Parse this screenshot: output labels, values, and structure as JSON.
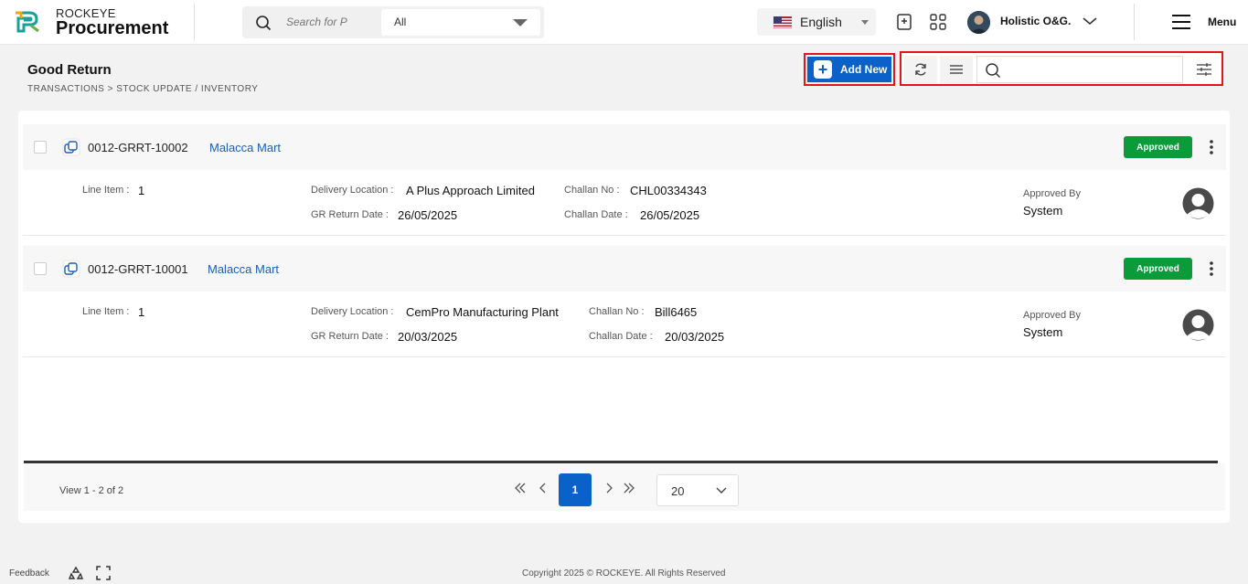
{
  "app": {
    "brand_top": "ROCKEYE",
    "brand_main": "Procurement"
  },
  "header": {
    "search_placeholder": "Search for P",
    "search_scope": "All",
    "language": "English",
    "user_name": "Holistic O&G.",
    "menu_label": "Menu"
  },
  "page": {
    "title": "Good Return",
    "breadcrumb": "TRANSACTIONS >  STOCK UPDATE  /  INVENTORY",
    "add_new_label": "Add New"
  },
  "labels": {
    "line_item": "Line Item :",
    "delivery_location": "Delivery Location :",
    "gr_return_date": "GR Return Date :",
    "challan_no": "Challan No :",
    "challan_date": "Challan Date :",
    "approved_by": "Approved By"
  },
  "records": [
    {
      "doc_no": "0012-GRRT-10002",
      "party": "Malacca Mart",
      "status": "Approved",
      "line_item": "1",
      "delivery_location": "A Plus Approach Limited",
      "gr_return_date": "26/05/2025",
      "challan_no": "CHL00334343",
      "challan_date": "26/05/2025",
      "approved_by": "System"
    },
    {
      "doc_no": "0012-GRRT-10001",
      "party": "Malacca Mart",
      "status": "Approved",
      "line_item": "1",
      "delivery_location": "CemPro Manufacturing Plant",
      "gr_return_date": "20/03/2025",
      "challan_no": "Bill6465",
      "challan_date": "20/03/2025",
      "approved_by": "System"
    }
  ],
  "pager": {
    "view_count": "View 1 - 2 of 2",
    "current_page": "1",
    "per_page": "20"
  },
  "footer": {
    "feedback": "Feedback",
    "copyright": "Copyright 2025 © ROCKEYE. All Rights Reserved"
  },
  "colors": {
    "primary": "#0a62c8",
    "approved": "#0c9b3a",
    "highlight": "#e0161c",
    "link": "#1a5fb4"
  },
  "icons": [
    "search-icon",
    "flag-us-icon",
    "bookmark-add-icon",
    "apps-grid-icon",
    "chevron-down-icon",
    "hamburger-menu-icon",
    "plus-icon",
    "refresh-icon",
    "list-icon",
    "filter-sliders-icon",
    "copy-icon",
    "kebab-icon",
    "user-avatar-icon",
    "first-page-icon",
    "prev-page-icon",
    "next-page-icon",
    "last-page-icon",
    "recycle-icon",
    "fullscreen-icon"
  ]
}
